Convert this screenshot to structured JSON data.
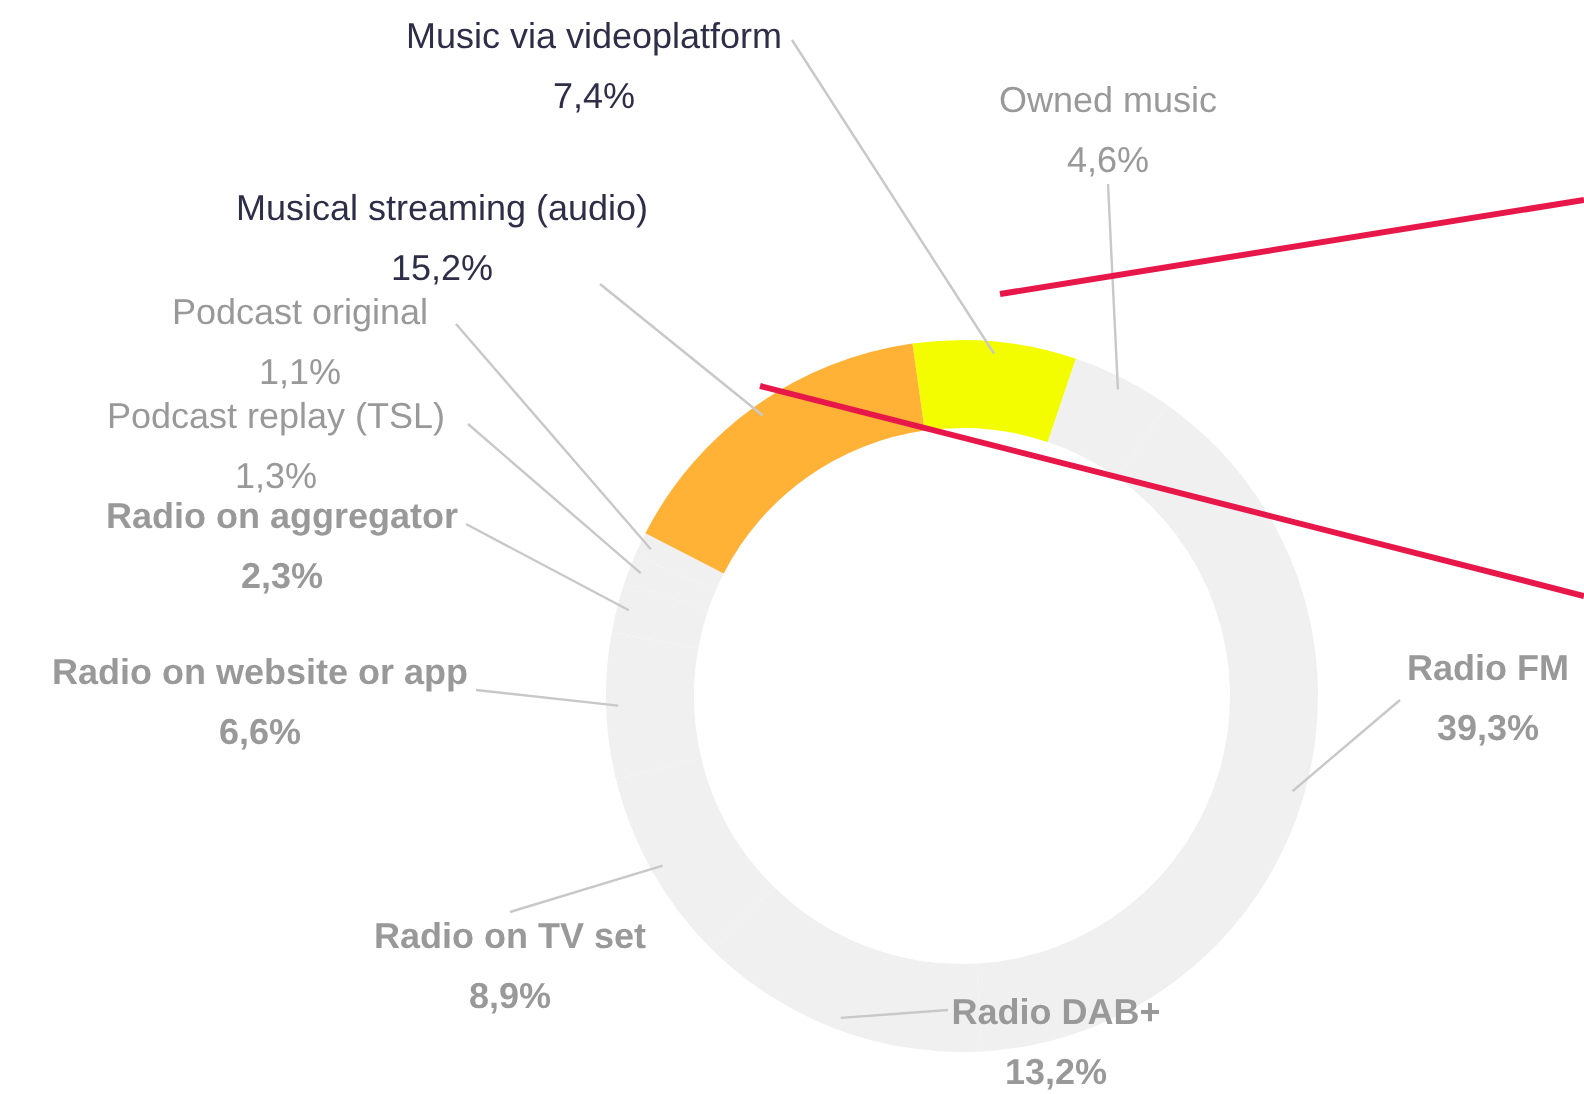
{
  "chart": {
    "chart_data": {
      "type": "donut",
      "categories": [
        "Music via videoplatform",
        "Owned music",
        "Radio FM",
        "Radio DAB+",
        "Radio on TV set",
        "Radio on website or app",
        "Radio on aggregator",
        "Podcast replay (TSL)",
        "Podcast original",
        "Musical streaming (audio)"
      ],
      "values": [
        7.4,
        4.6,
        39.3,
        13.2,
        8.9,
        6.6,
        2.3,
        1.3,
        1.1,
        15.2
      ],
      "value_labels": [
        "7,4%",
        "4,6%",
        "39,3%",
        "13,2%",
        "8,9%",
        "6,6%",
        "2,3%",
        "1,3%",
        "1,1%",
        "15,2%"
      ],
      "colors": [
        "#f4fc00",
        "#f0f0f0",
        "#f0f0f0",
        "#f0f0f0",
        "#f0f0f0",
        "#f0f0f0",
        "#f0f0f0",
        "#f0f0f0",
        "#f0f0f0",
        "#ffb236"
      ]
    },
    "callouts": [
      {
        "kind": "regular",
        "highlighted": true
      },
      {
        "kind": "regular",
        "highlighted": false
      },
      {
        "kind": "bold",
        "highlighted": false
      },
      {
        "kind": "bold",
        "highlighted": false
      },
      {
        "kind": "bold",
        "highlighted": false
      },
      {
        "kind": "bold",
        "highlighted": false
      },
      {
        "kind": "bold",
        "highlighted": false
      },
      {
        "kind": "regular",
        "highlighted": false
      },
      {
        "kind": "regular",
        "highlighted": false
      },
      {
        "kind": "regular",
        "highlighted": true
      }
    ]
  }
}
